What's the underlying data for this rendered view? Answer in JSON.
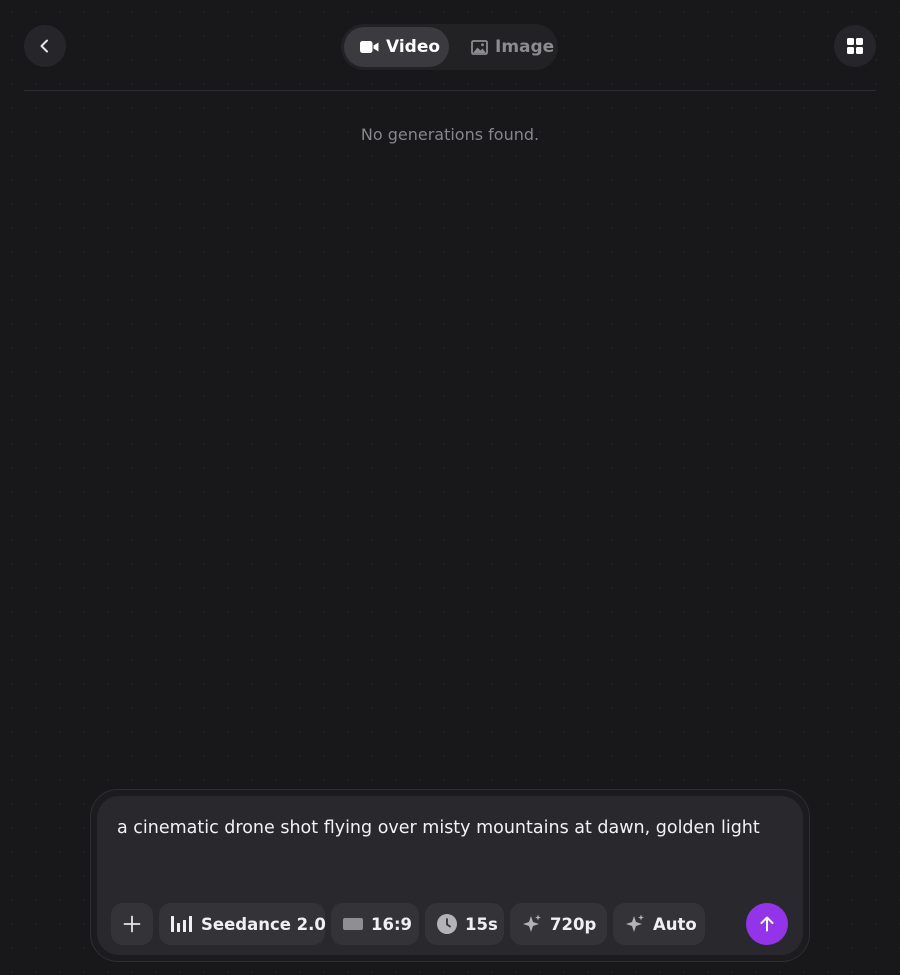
{
  "colors": {
    "background": "#18181a",
    "accent": "#9333ea",
    "active_tab": "#3a3a3f",
    "chip": "#333338",
    "muted_text": "#86868b"
  },
  "header": {
    "back_icon": "chevron-left-icon",
    "grid_icon": "grid-icon",
    "tabs": [
      {
        "label": "Video",
        "icon": "video-camera-icon",
        "active": true
      },
      {
        "label": "Image",
        "icon": "image-icon",
        "active": false
      }
    ]
  },
  "main": {
    "empty_message": "No generations found."
  },
  "composer": {
    "prompt": "a cinematic drone shot flying over misty mountains at dawn, golden light",
    "add_icon": "plus-icon",
    "chips": {
      "model": {
        "label": "Seedance 2.0",
        "icon": "bars-icon"
      },
      "aspect": {
        "label": "16:9",
        "icon": "aspect-ratio-icon"
      },
      "duration": {
        "label": "15s",
        "icon": "clock-icon"
      },
      "quality": {
        "label": "720p",
        "icon": "sparkle-icon"
      },
      "mode": {
        "label": "Auto",
        "icon": "sparkle-icon"
      }
    },
    "send_icon": "arrow-up-icon"
  }
}
